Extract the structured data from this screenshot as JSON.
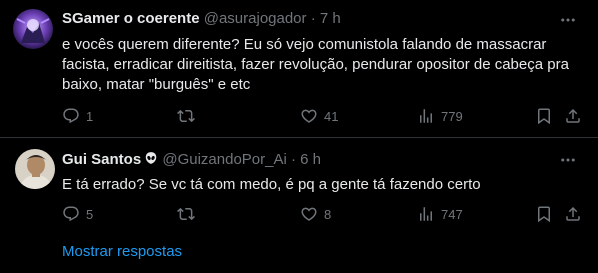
{
  "theme": {
    "background": "#000000",
    "text": "#e7e9ea",
    "muted": "#71767b",
    "link": "#1d9bf0",
    "divider": "#2f3336"
  },
  "tweets": [
    {
      "name": "SGamer o coerente",
      "handle": "@asurajogador",
      "separator": "·",
      "time": "7 h",
      "text": "e vocês querem diferente? Eu só vejo comunistola falando de massacrar facista, erradicar direitista, fazer revolução, pendurar opositor de cabeça pra baixo, matar \"burguês\" e etc",
      "replies": "1",
      "retweets": "",
      "likes": "41",
      "views": "779"
    },
    {
      "name": "Gui Santos",
      "handle": "@GuizandoPor_Ai",
      "separator": "·",
      "time": "6 h",
      "badge_icon": "alien-emoji-icon",
      "text": "E tá errado? Se vc tá com medo, é pq a gente tá fazendo certo",
      "replies": "5",
      "retweets": "",
      "likes": "8",
      "views": "747"
    }
  ],
  "footer": {
    "show_replies_label": "Mostrar respostas"
  }
}
